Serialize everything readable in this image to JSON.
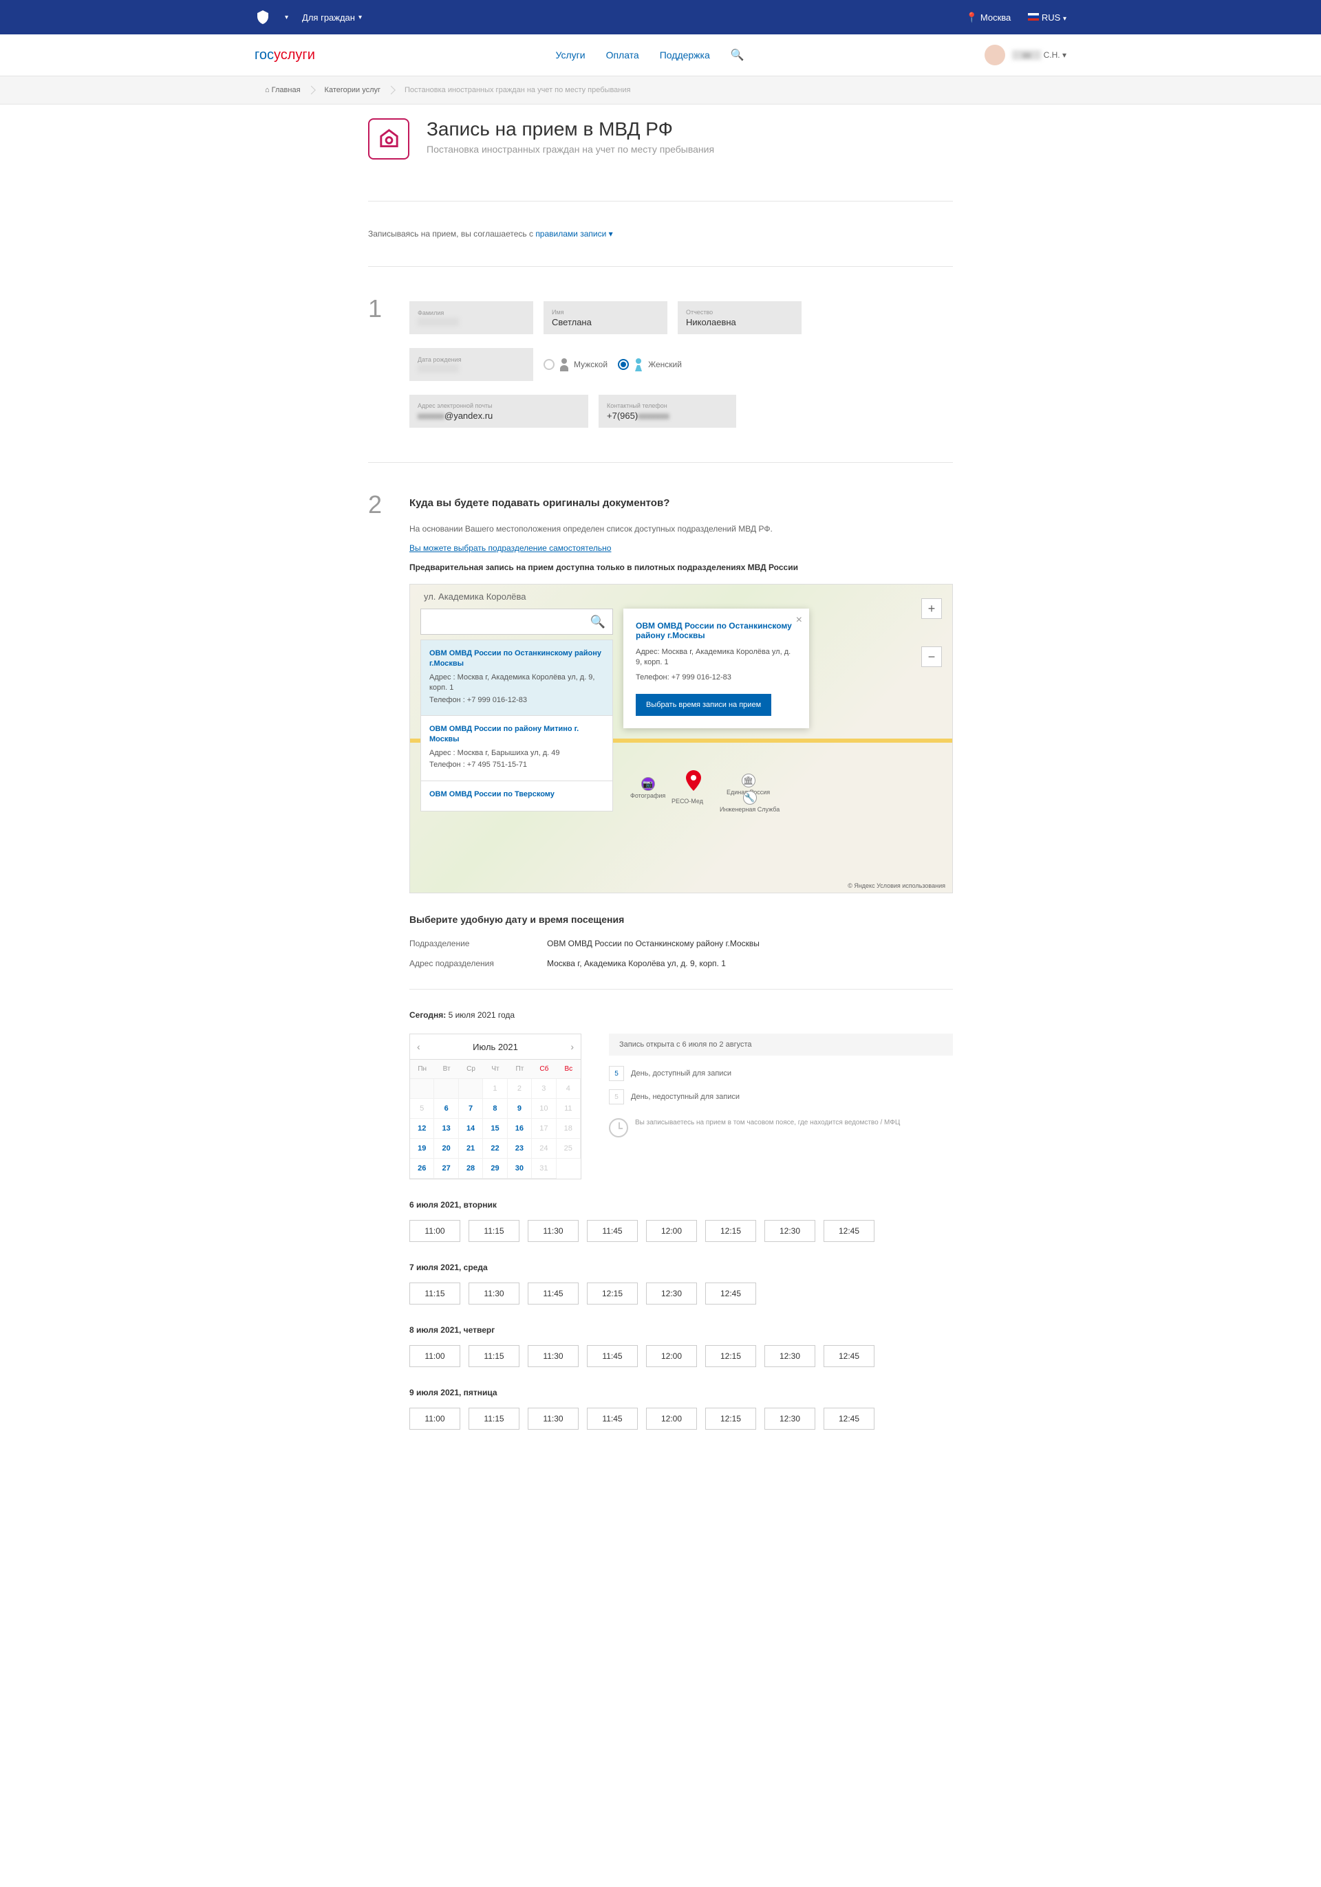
{
  "topbar": {
    "for_citizens": "Для граждан",
    "city": "Москва",
    "lang": "RUS"
  },
  "header": {
    "logo_gos": "гос",
    "logo_usl": "услуги",
    "nav_services": "Услуги",
    "nav_payment": "Оплата",
    "nav_support": "Поддержка",
    "user_name": "С.Н."
  },
  "breadcrumb": {
    "home": "Главная",
    "cat": "Категории услуг",
    "cur": "Постановка иностранных граждан на учет по месту пребывания"
  },
  "page": {
    "title": "Запись на прием в МВД РФ",
    "subtitle": "Постановка иностранных граждан на учет по месту пребывания",
    "terms_pre": "Записываясь на прием, вы соглашаетесь с ",
    "terms_link": "правилами записи"
  },
  "form": {
    "surname_label": "Фамилия",
    "name_label": "Имя",
    "name_val": "Светлана",
    "patr_label": "Отчество",
    "patr_val": "Николаевна",
    "dob_label": "Дата рождения",
    "gender_m": "Мужской",
    "gender_f": "Женский",
    "email_label": "Адрес электронной почты",
    "email_val": "@yandex.ru",
    "phone_label": "Контактный телефон",
    "phone_val": "+7(965)"
  },
  "step2": {
    "title": "Куда вы будете подавать оригиналы документов?",
    "info1": "На основании Вашего местоположения определен список доступных подразделений МВД РФ.",
    "link": "Вы можете выбрать подразделение самостоятельно",
    "info2": "Предварительная запись на прием доступна только в пилотных подразделениях МВД России"
  },
  "map": {
    "street": "ул. Академика Королёва",
    "items": [
      {
        "title": "ОВМ ОМВД России по Останкинскому району г.Москвы",
        "addr": "Адрес : Москва г, Академика Королёва ул, д. 9, корп. 1",
        "phone": "Телефон : +7 999 016-12-83"
      },
      {
        "title": "ОВМ ОМВД России по району Митино г. Москвы",
        "addr": "Адрес : Москва г, Барышиха ул, д. 49",
        "phone": "Телефон : +7 495 751-15-71"
      },
      {
        "title": "ОВМ ОМВД России по Тверскому",
        "addr": "",
        "phone": ""
      }
    ],
    "popup": {
      "title": "ОВМ ОМВД России по Останкинскому району г.Москвы",
      "addr": "Адрес: Москва г, Академика Королёва ул, д. 9, корп. 1",
      "phone": "Телефон: +7 999 016-12-83",
      "btn": "Выбрать время записи на прием"
    },
    "attr": "© Яндекс Условия использования",
    "poi1": "Фотография",
    "poi2": "Единая Россия",
    "poi3": "Инженерная Служба",
    "poi4": "РЕСО-Мед"
  },
  "chosen": {
    "heading": "Выберите удобную дату и время посещения",
    "unit_label": "Подразделение",
    "unit_val": "ОВМ ОМВД России по Останкинскому району г.Москвы",
    "addr_label": "Адрес подразделения",
    "addr_val": "Москва г, Академика Королёва ул, д. 9, корп. 1"
  },
  "today": {
    "label": "Сегодня:",
    "val": "5 июля 2021 года"
  },
  "calendar": {
    "month": "Июль 2021",
    "dow": [
      "Пн",
      "Вт",
      "Ср",
      "Чт",
      "Пт",
      "Сб",
      "Вс"
    ],
    "legend_title": "Запись открыта с 6 июля по 2 августа",
    "legend_avail": "День, доступный для записи",
    "legend_navail": "День, недоступный для записи",
    "tz_note": "Вы записываетесь на прием в том часовом поясе, где находится ведомство / МФЦ"
  },
  "days": [
    {
      "title": "6 июля 2021, вторник",
      "slots": [
        "11:00",
        "11:15",
        "11:30",
        "11:45",
        "12:00",
        "12:15",
        "12:30",
        "12:45"
      ]
    },
    {
      "title": "7 июля 2021, среда",
      "slots": [
        "11:15",
        "11:30",
        "11:45",
        "12:15",
        "12:30",
        "12:45"
      ]
    },
    {
      "title": "8 июля 2021, четверг",
      "slots": [
        "11:00",
        "11:15",
        "11:30",
        "11:45",
        "12:00",
        "12:15",
        "12:30",
        "12:45"
      ]
    },
    {
      "title": "9 июля 2021, пятница",
      "slots": [
        "11:00",
        "11:15",
        "11:30",
        "11:45",
        "12:00",
        "12:15",
        "12:30",
        "12:45"
      ]
    }
  ]
}
